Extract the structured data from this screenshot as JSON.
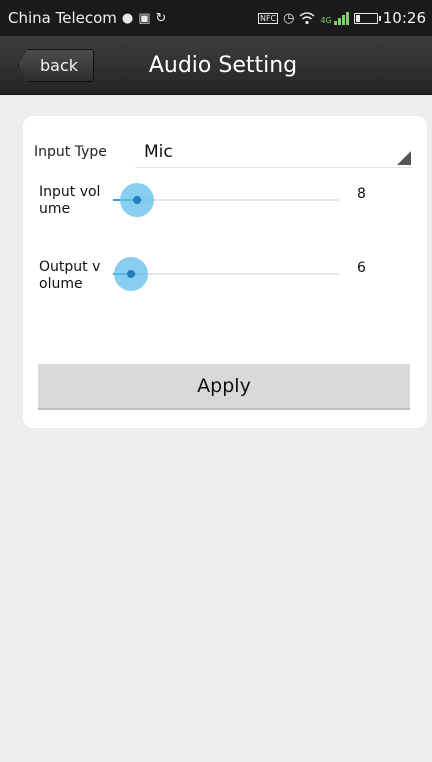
{
  "status_bar": {
    "carrier": "China Telecom",
    "time": "10:26",
    "icons_left": [
      "wechat-icon",
      "image-icon",
      "sync-icon"
    ],
    "icons_right": [
      "nfc-icon",
      "alarm-icon",
      "wifi-icon",
      "signal-icon",
      "battery-icon"
    ],
    "nfc_label": "NFC",
    "network_label": "4G"
  },
  "header": {
    "back_label": "back",
    "title": "Audio Setting"
  },
  "form": {
    "input_type_label": "Input Type",
    "input_type_value": "Mic",
    "input_volume_label": "Input volume",
    "input_volume_value": "8",
    "input_volume_level": 0.06,
    "output_volume_label": "Output volume",
    "output_volume_value": "6",
    "output_volume_level": 0.03,
    "apply_label": "Apply"
  },
  "colors": {
    "status_bar_bg": "#1a1a1a",
    "title_bar_bg": "#2b2d2f",
    "page_bg": "#ededed",
    "slider_accent": "#60bee8",
    "button_bg": "#d9d9d9"
  }
}
